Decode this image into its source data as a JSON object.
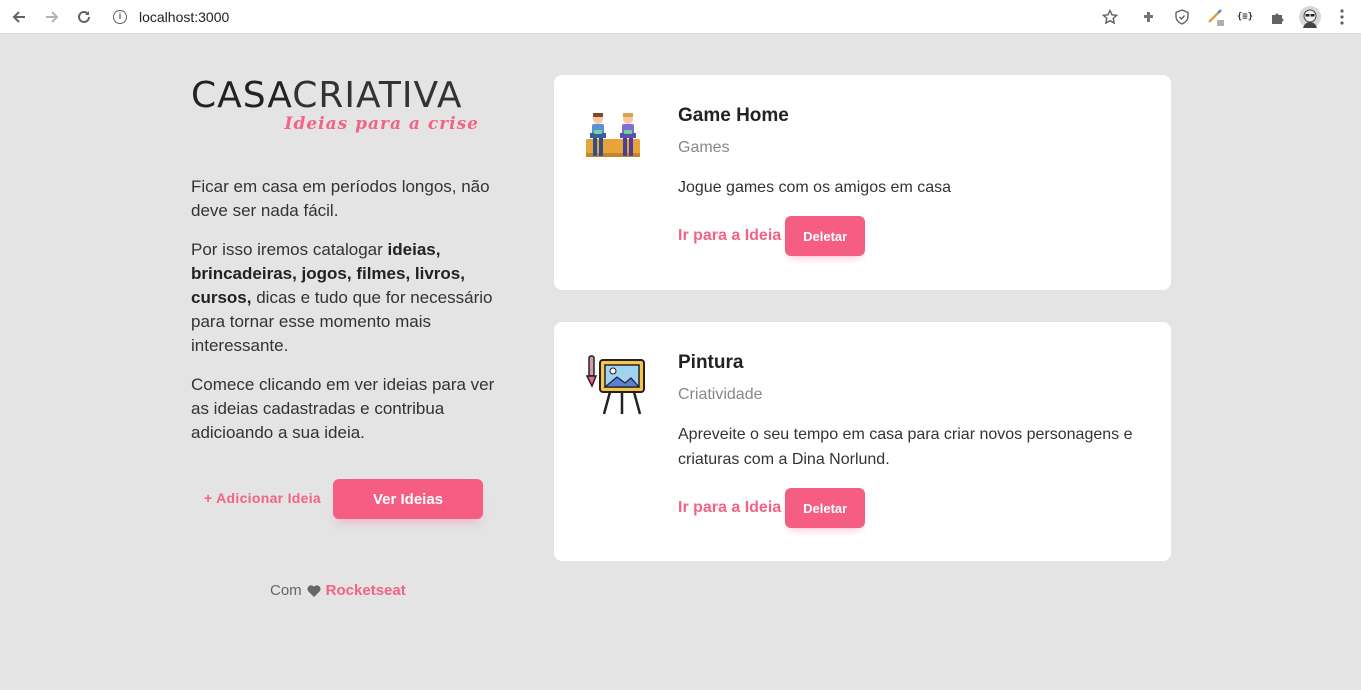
{
  "browser": {
    "url": "localhost:3000",
    "icons": [
      "back-icon",
      "forward-icon",
      "reload-icon",
      "info-icon",
      "star-icon",
      "extension-icon",
      "shield-icon",
      "pen-icon",
      "braces-icon",
      "puzzle-icon",
      "avatar",
      "more-icon"
    ],
    "braces_label": "{≡}"
  },
  "logo": {
    "part1": "CASA",
    "part2": "CRIATIVA",
    "tagline": "Ideias para a crise"
  },
  "intro": {
    "p1": "Ficar em casa em períodos longos, não deve ser nada fácil.",
    "p2_start": "Por isso iremos catalogar ",
    "p2_bold": "ideias, brincadeiras, jogos, filmes, livros, cursos,",
    "p2_end": " dicas e tudo que for necessário para tornar esse momento mais interessante.",
    "p3": "Comece clicando em ver ideias para ver as ideias cadastradas e contribua adicioando a sua ideia."
  },
  "actions": {
    "add_label": "+ Adicionar Ideia",
    "view_label": "Ver Ideias"
  },
  "footer": {
    "prefix": "Com",
    "brand": "Rocketseat"
  },
  "ideas": [
    {
      "title": "Game Home",
      "category": "Games",
      "description": "Jogue games com os amigos em casa",
      "link_label": "Ir para a Ideia",
      "delete_label": "Deletar",
      "icon": "gamers-icon"
    },
    {
      "title": "Pintura",
      "category": "Criatividade",
      "description": "Apreveite o seu tempo em casa para criar novos personagens e criaturas com a Dina Norlund.",
      "link_label": "Ir para a Ideia",
      "delete_label": "Deletar",
      "icon": "easel-icon"
    }
  ],
  "colors": {
    "accent": "#f55d83",
    "background": "#e4e4e4"
  }
}
